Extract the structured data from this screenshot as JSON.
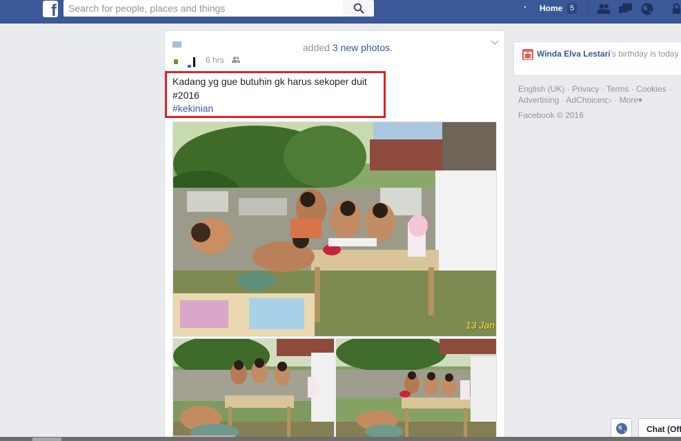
{
  "topbar": {
    "search_placeholder": "Search for people, places and things",
    "home_label": "Home",
    "home_count": "5",
    "icons": [
      "friend-requests-icon",
      "messages-icon",
      "notifications-globe-icon",
      "lock-icon"
    ]
  },
  "post": {
    "action_prefix": "added ",
    "action_link": "3 new photos",
    "action_suffix": ".",
    "time": "6 hrs",
    "caption_line1": "Kadang yg gue butuhin gk harus sekoper duit",
    "caption_line2": "#2016",
    "hashtag": "#kekinian",
    "photo_date_stamp": "13 Jan",
    "highlight_color": "#e0202a"
  },
  "sidebar": {
    "birthday_name": "Winda Elva Lestari",
    "birthday_suffix": "'s birthday is today",
    "footer_links": {
      "english": "English (UK)",
      "privacy": "Privacy",
      "terms": "Terms",
      "cookies": "Cookies",
      "advertising": "Advertising",
      "adchoices": "AdChoices",
      "more": "More"
    },
    "copyright": "Facebook © 2016"
  },
  "chat": {
    "label": "Chat (Off"
  },
  "colors": {
    "brand": "#3b5998",
    "link": "#365899",
    "background": "#e9ebee"
  }
}
